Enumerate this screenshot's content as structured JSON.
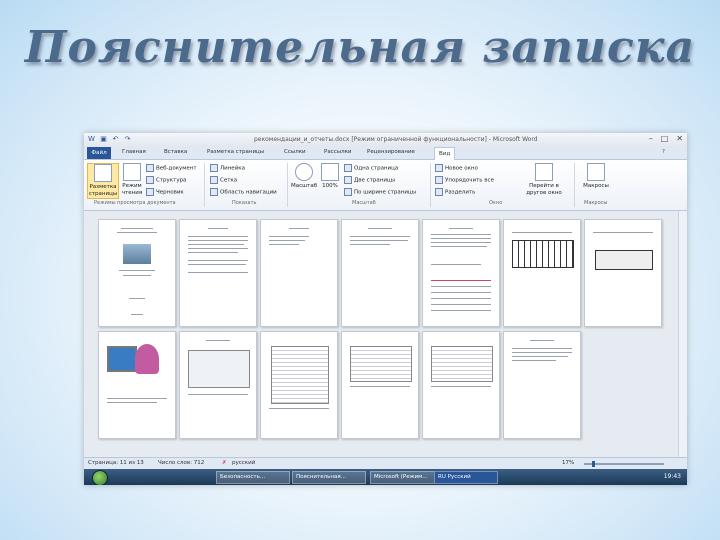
{
  "slide": {
    "title": "Пояснительная записка"
  },
  "window": {
    "title": "рекомендации_и_отчеты.docx [Режим ограниченной функциональности] - Microsoft Word",
    "controls": [
      "–",
      "□",
      "✕"
    ]
  },
  "menu": {
    "tabs": [
      "Файл",
      "Главная",
      "Вставка",
      "Разметка страницы",
      "Ссылки",
      "Рассылки",
      "Рецензирование",
      "Вид"
    ],
    "active_tab": "Вид"
  },
  "ribbon": {
    "view_modes": {
      "layout": "Разметка страницы",
      "reading": "Режим чтения",
      "web": "Веб-документ",
      "outline": "Структура",
      "draft": "Черновик",
      "group_label": "Режимы просмотра документа"
    },
    "show": {
      "ruler": "Линейка",
      "grid": "Сетка",
      "nav": "Область навигации",
      "group_label": "Показать"
    },
    "zoom": {
      "zoom": "Масштаб",
      "pct100": "100%",
      "one_page": "Одна страница",
      "two_pages": "Две страницы",
      "page_width": "По ширине страницы",
      "group_label": "Масштаб"
    },
    "window": {
      "new_window": "Новое окно",
      "arrange_all": "Упорядочить все",
      "split": "Разделить",
      "switch": "Перейти в другое окно",
      "group_label": "Окно"
    },
    "macros": {
      "macros": "Макросы",
      "group_label": "Макросы"
    }
  },
  "status": {
    "page": "Страница: 11 из 13",
    "words": "Число слов: 712",
    "language": "русский",
    "zoom": "17%"
  },
  "taskbar": {
    "buttons": [
      "Безопасность...",
      "Пояснительная...",
      "Microsoft (Режим..."
    ],
    "language": "RU Русский",
    "time": "19:43"
  }
}
